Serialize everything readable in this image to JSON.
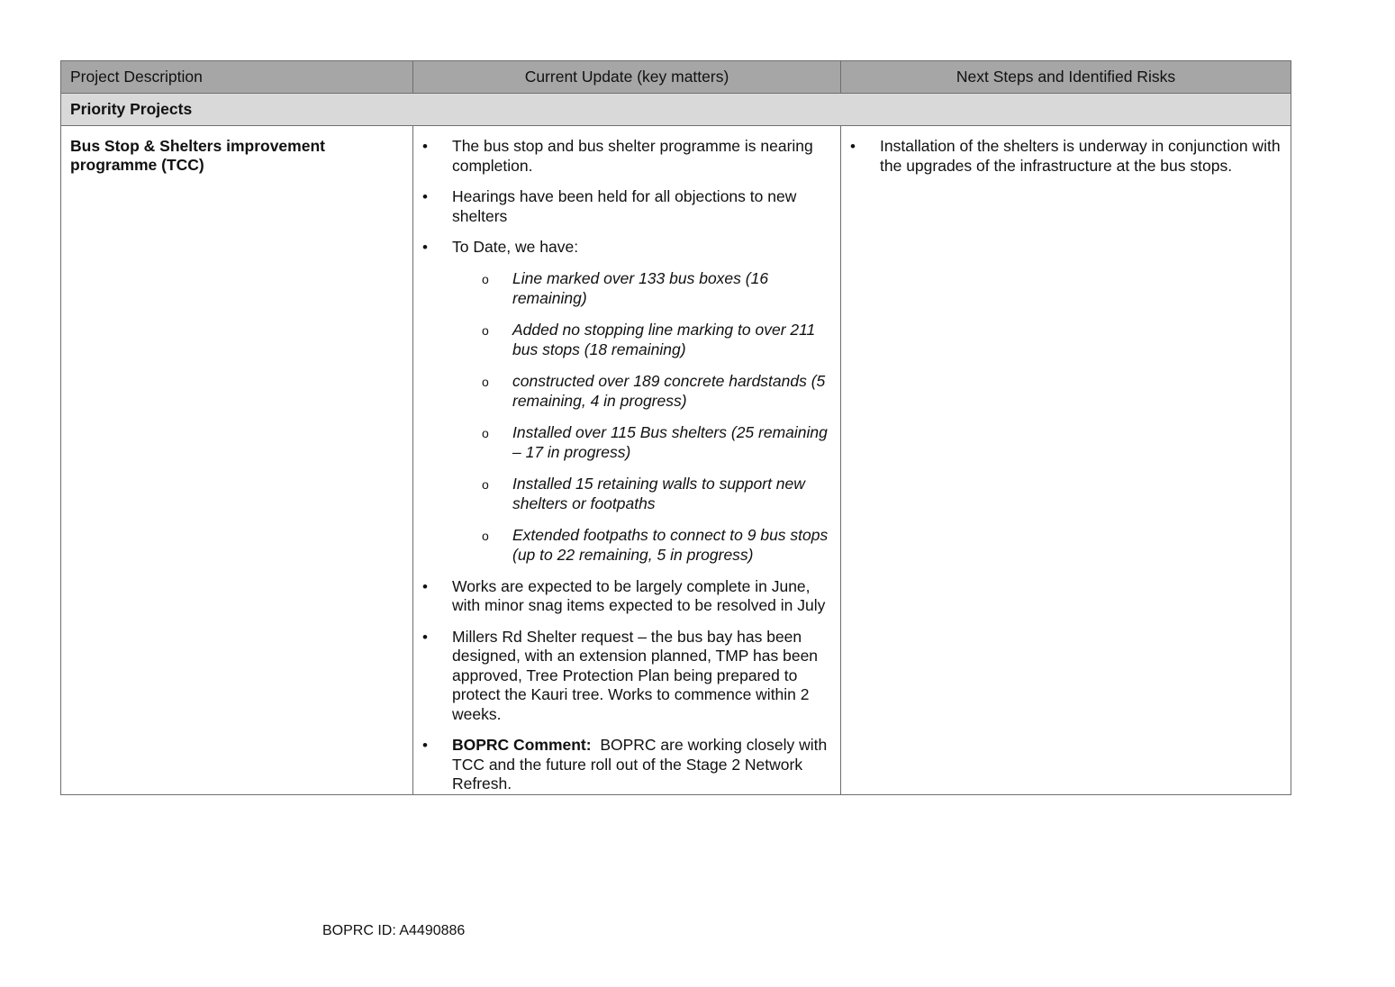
{
  "table": {
    "headers": {
      "project_description": "Project Description",
      "current_update": "Current Update (key matters)",
      "next_steps": "Next Steps and Identified Risks"
    },
    "section_title": "Priority Projects",
    "project": {
      "name": "Bus Stop & Shelters improvement programme (TCC)",
      "updates": [
        "The bus stop and bus shelter programme is nearing completion.",
        "Hearings have been held for all objections to new shelters",
        "To Date, we have:",
        "Works are expected to be largely complete in June, with minor snag items expected to be resolved in July",
        "Millers Rd Shelter request – the bus bay has been designed, with an extension planned, TMP has been approved, Tree Protection Plan being prepared to protect the Kauri tree. Works to commence within 2 weeks."
      ],
      "to_date_items": [
        "Line marked over 133 bus boxes (16 remaining)",
        "Added no stopping line marking to over 211 bus stops (18 remaining)",
        "constructed over 189 concrete hardstands (5 remaining, 4 in progress)",
        "Installed over 115 Bus shelters (25 remaining – 17 in progress)",
        "Installed 15 retaining walls to support new shelters or footpaths",
        "Extended footpaths to connect to 9 bus stops (up to 22 remaining, 5 in progress)"
      ],
      "sub_marker": "o",
      "comment_label": "BOPRC Comment:",
      "comment_text": "BOPRC are working closely with TCC and the future roll out of the Stage 2 Network Refresh.",
      "next_steps": [
        "Installation of the shelters is underway in conjunction with the upgrades of the infrastructure at the bus stops."
      ]
    }
  },
  "footer": {
    "document_id": "BOPRC ID: A4490886"
  }
}
